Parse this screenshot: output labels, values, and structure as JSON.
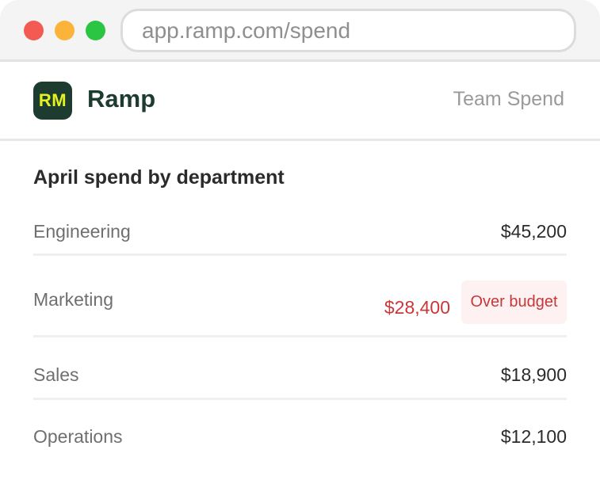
{
  "browser": {
    "url": "app.ramp.com/spend",
    "controls": [
      "close",
      "minimize",
      "maximize"
    ]
  },
  "header": {
    "logo_text": "RM",
    "brand_name": "Ramp",
    "right_label": "Team Spend"
  },
  "colors": {
    "brand_dark": "#1d3c2f",
    "brand_accent": "#e4f222",
    "alert": "#c8373a",
    "alert_bg": "#fdf1f1"
  },
  "main": {
    "title": "April spend by department",
    "rows": [
      {
        "department": "Engineering",
        "amount": "$45,200"
      },
      {
        "department": "Marketing",
        "amount": "$28,400",
        "status": "Over budget"
      },
      {
        "department": "Sales",
        "amount": "$18,900"
      },
      {
        "department": "Operations",
        "amount": "$12,100"
      }
    ]
  }
}
